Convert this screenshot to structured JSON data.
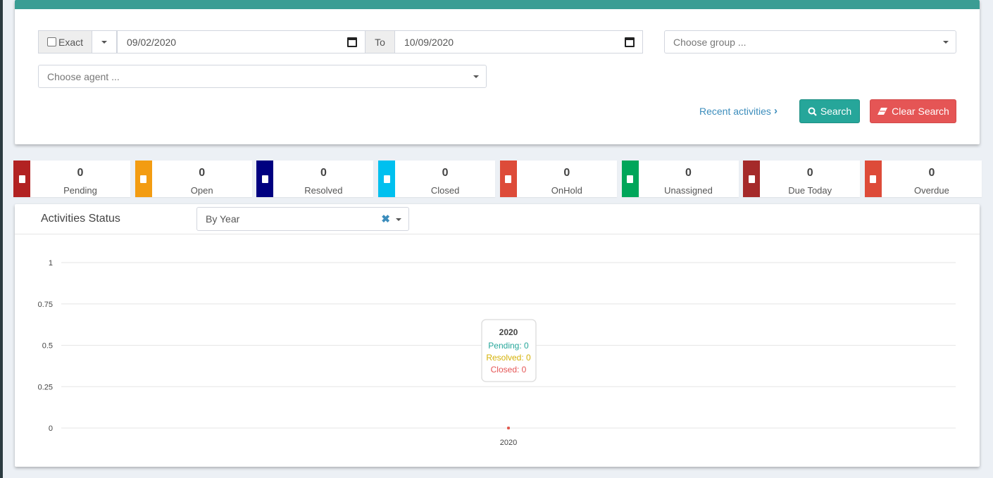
{
  "filters": {
    "exact_label": "Exact",
    "date_from": "09/02/2020",
    "to_label": "To",
    "date_to": "10/09/2020",
    "group_placeholder": "Choose group ...",
    "agent_placeholder": "Choose agent ...",
    "recent_link": "Recent activities",
    "search_label": "Search",
    "clear_label": "Clear Search"
  },
  "stats": [
    {
      "value": "0",
      "label": "Pending",
      "color": "#b22222"
    },
    {
      "value": "0",
      "label": "Open",
      "color": "#f39c12"
    },
    {
      "value": "0",
      "label": "Resolved",
      "color": "#000080"
    },
    {
      "value": "0",
      "label": "Closed",
      "color": "#00c0ef"
    },
    {
      "value": "0",
      "label": "OnHold",
      "color": "#dd4b39"
    },
    {
      "value": "0",
      "label": "Unassigned",
      "color": "#00a65a"
    },
    {
      "value": "0",
      "label": "Due Today",
      "color": "#a52a2a"
    },
    {
      "value": "0",
      "label": "Overdue",
      "color": "#dd4b39"
    }
  ],
  "chart_panel": {
    "title": "Activities Status",
    "period": "By Year"
  },
  "chart_data": {
    "type": "line",
    "categories": [
      "2020"
    ],
    "series": [
      {
        "name": "Pending",
        "values": [
          0
        ],
        "color": "#26a69a"
      },
      {
        "name": "Resolved",
        "values": [
          0
        ],
        "color": "#d4b106"
      },
      {
        "name": "Closed",
        "values": [
          0
        ],
        "color": "#e55555"
      }
    ],
    "ylim": [
      0,
      1
    ],
    "yticks": [
      "0",
      "0.25",
      "0.5",
      "0.75",
      "1"
    ],
    "grid": true,
    "tooltip": {
      "title": "2020",
      "lines": [
        "Pending: 0",
        "Resolved: 0",
        "Closed: 0"
      ]
    }
  }
}
